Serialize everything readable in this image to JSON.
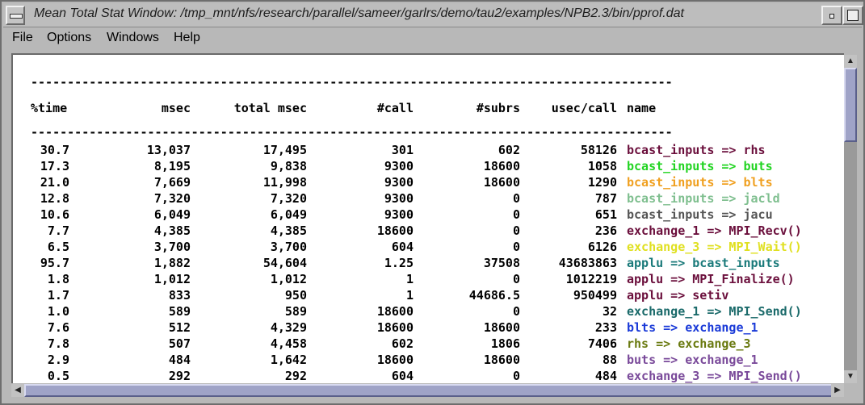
{
  "window": {
    "title": "Mean Total Stat Window: /tmp_mnt/nfs/research/parallel/sameer/garlrs/demo/tau2/examples/NPB2.3/bin/pprof.dat"
  },
  "menubar": {
    "items": [
      "File",
      "Options",
      "Windows",
      "Help"
    ]
  },
  "icons": {
    "window_menu": "window-menu-icon",
    "minimize": "minimize-icon",
    "maximize": "maximize-icon",
    "scroll_up": "arrow-up-icon",
    "scroll_down": "arrow-down-icon",
    "scroll_left": "arrow-left-icon",
    "scroll_right": "arrow-right-icon"
  },
  "table": {
    "separator": "----------------------------------------------------------------------------------------",
    "headers": [
      "%time",
      "msec",
      "total msec",
      "#call",
      "#subrs",
      "usec/call",
      "name"
    ],
    "rows": [
      {
        "time": "30.7",
        "msec": "13,037",
        "total": "17,495",
        "call": "301",
        "subrs": "602",
        "usec": "58126",
        "name": "bcast_inputs => rhs",
        "color": "#6b0f3c"
      },
      {
        "time": "17.3",
        "msec": "8,195",
        "total": "9,838",
        "call": "9300",
        "subrs": "18600",
        "usec": "1058",
        "name": "bcast_inputs => buts",
        "color": "#22d422"
      },
      {
        "time": "21.0",
        "msec": "7,669",
        "total": "11,998",
        "call": "9300",
        "subrs": "18600",
        "usec": "1290",
        "name": "bcast_inputs => blts",
        "color": "#f0a020"
      },
      {
        "time": "12.8",
        "msec": "7,320",
        "total": "7,320",
        "call": "9300",
        "subrs": "0",
        "usec": "787",
        "name": "bcast_inputs => jacld",
        "color": "#7fbf8f"
      },
      {
        "time": "10.6",
        "msec": "6,049",
        "total": "6,049",
        "call": "9300",
        "subrs": "0",
        "usec": "651",
        "name": "bcast_inputs => jacu",
        "color": "#555555"
      },
      {
        "time": "7.7",
        "msec": "4,385",
        "total": "4,385",
        "call": "18600",
        "subrs": "0",
        "usec": "236",
        "name": "exchange_1 => MPI_Recv()",
        "color": "#6b0f3c"
      },
      {
        "time": "6.5",
        "msec": "3,700",
        "total": "3,700",
        "call": "604",
        "subrs": "0",
        "usec": "6126",
        "name": "exchange_3 => MPI_Wait()",
        "color": "#e0e020"
      },
      {
        "time": "95.7",
        "msec": "1,882",
        "total": "54,604",
        "call": "1.25",
        "subrs": "37508",
        "usec": "43683863",
        "name": "applu => bcast_inputs",
        "color": "#1a7a7a"
      },
      {
        "time": "1.8",
        "msec": "1,012",
        "total": "1,012",
        "call": "1",
        "subrs": "0",
        "usec": "1012219",
        "name": "applu => MPI_Finalize()",
        "color": "#6b0f3c"
      },
      {
        "time": "1.7",
        "msec": "833",
        "total": "950",
        "call": "1",
        "subrs": "44686.5",
        "usec": "950499",
        "name": "applu => setiv",
        "color": "#6b0f3c"
      },
      {
        "time": "1.0",
        "msec": "589",
        "total": "589",
        "call": "18600",
        "subrs": "0",
        "usec": "32",
        "name": "exchange_1 => MPI_Send()",
        "color": "#1a6a6a"
      },
      {
        "time": "7.6",
        "msec": "512",
        "total": "4,329",
        "call": "18600",
        "subrs": "18600",
        "usec": "233",
        "name": "blts => exchange_1",
        "color": "#1a3ad8"
      },
      {
        "time": "7.8",
        "msec": "507",
        "total": "4,458",
        "call": "602",
        "subrs": "1806",
        "usec": "7406",
        "name": "rhs => exchange_3",
        "color": "#6a7a10"
      },
      {
        "time": "2.9",
        "msec": "484",
        "total": "1,642",
        "call": "18600",
        "subrs": "18600",
        "usec": "88",
        "name": "buts => exchange_1",
        "color": "#7a4a9a"
      },
      {
        "time": "0.5",
        "msec": "292",
        "total": "292",
        "call": "604",
        "subrs": "0",
        "usec": "484",
        "name": "exchange_3 => MPI_Send()",
        "color": "#7a4a9a"
      }
    ]
  }
}
